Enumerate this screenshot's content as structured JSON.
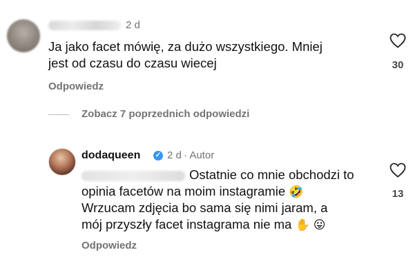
{
  "comment1": {
    "time": "2 d",
    "text_line1": "Ja jako facet mówię, za dużo wszystkiego. Mniej",
    "text_line2": "jest od czasu do czasu wiecej",
    "reply_label": "Odpowiedz",
    "likes": "30"
  },
  "thread": {
    "view_previous_label": "Zobacz 7 poprzednich odpowiedzi"
  },
  "comment2": {
    "username": "dodaqueen",
    "time": "2 d",
    "author_label": "· Autor",
    "text_line1": "Ostatnie co mnie obchodzi to",
    "text_line2": "opinia facetów na moim instagramie",
    "text_line3": "Wrzucam zdjęcia bo sama się nimi jaram, a",
    "text_line4": "mój przyszły facet instagrama nie ma",
    "emoji_laugh": "🤣",
    "emoji_hand": "✋",
    "emoji_tongue": "😛",
    "reply_label": "Odpowiedz",
    "likes": "13"
  },
  "icons": {
    "like": "heart-icon",
    "verified": "verified-badge-icon"
  }
}
